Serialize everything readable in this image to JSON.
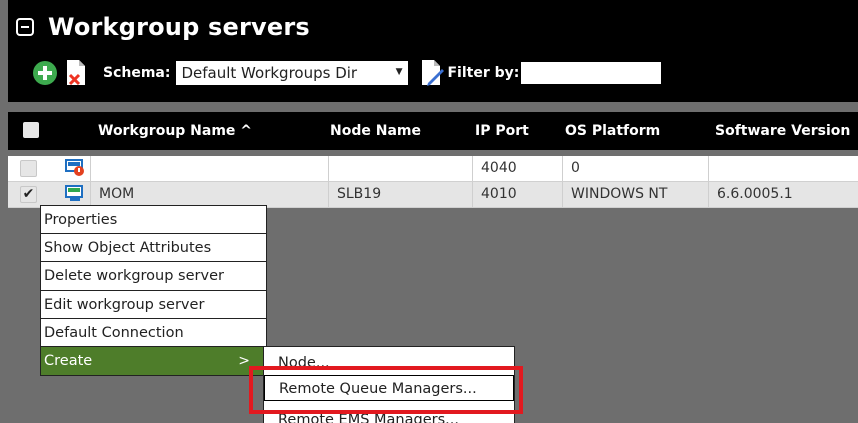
{
  "header": {
    "title": "Workgroup servers",
    "schema_label": "Schema:",
    "schema_value": "Default Workgroups Dir",
    "filter_label": "Filter by:",
    "filter_value": ""
  },
  "columns": [
    {
      "label": "Workgroup Name ^"
    },
    {
      "label": "Node Name"
    },
    {
      "label": "IP Port"
    },
    {
      "label": "OS Platform"
    },
    {
      "label": "Software Version"
    }
  ],
  "rows": [
    {
      "checked": "",
      "workgroup_name": "",
      "node_name": "",
      "ip_port": "4040",
      "os_platform": "0",
      "software_version": ""
    },
    {
      "checked": "✔",
      "workgroup_name": "MOM",
      "node_name": "SLB19",
      "ip_port": "4010",
      "os_platform": "WINDOWS NT",
      "software_version": "6.6.0005.1"
    }
  ],
  "context_menu": {
    "items": [
      "Properties",
      "Show Object Attributes",
      "Delete workgroup server",
      "Edit workgroup server",
      "Default Connection",
      "Create"
    ],
    "submenu_arrow": ">"
  },
  "submenu": {
    "items": [
      "Node...",
      "Remote Queue Managers...",
      "Remote EMS Managers..."
    ]
  },
  "colors": {
    "header_bg": "#000000",
    "add_icon": "#3daa4e",
    "active_menu": "#4e7d2a",
    "highlight_box": "#e2191f"
  }
}
